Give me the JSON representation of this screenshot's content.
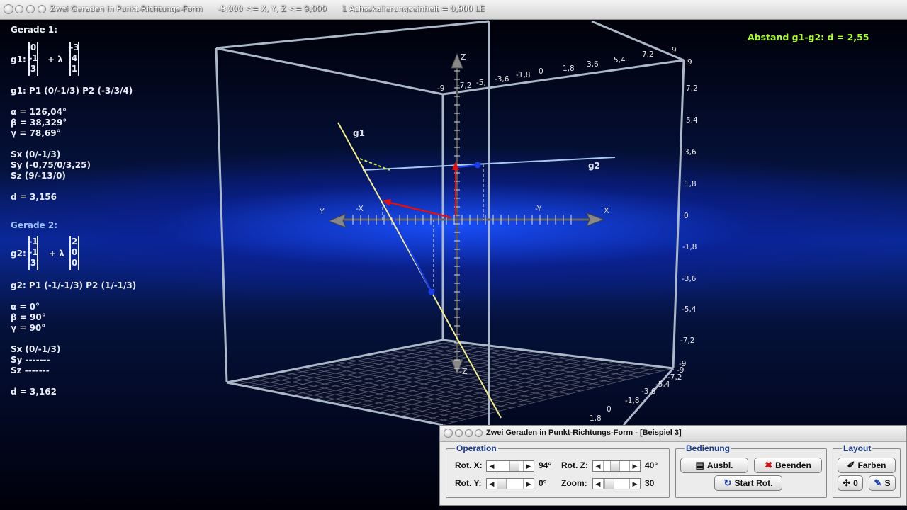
{
  "window": {
    "title": "Zwei Geraden in Punkt-Richtungs-Form",
    "range": "-9,000 <= X, Y, Z <= 9,000",
    "scale": "1 Achsskalierungseinheit = 0,900 LE"
  },
  "info": {
    "g1": {
      "header": "Gerade 1:",
      "label": "g1:",
      "point": [
        "0",
        "-1",
        "3"
      ],
      "direction": [
        "-3",
        "4",
        "1"
      ],
      "lambda": "+ λ",
      "points": "g1: P1 (0/-1/3)    P2 (-3/3/4)",
      "alpha": "α = 126,04°",
      "beta": "β = 38,329°",
      "gamma": "γ = 78,69°",
      "sx": "Sx (0/-1/3)",
      "sy": "Sy (-0,75/0/3,25)",
      "sz": "Sz (9/-13/0)",
      "d": "d = 3,156"
    },
    "g2": {
      "header": "Gerade 2:",
      "label": "g2:",
      "point": [
        "-1",
        "-1",
        "3"
      ],
      "direction": [
        "2",
        "0",
        "0"
      ],
      "lambda": "+ λ",
      "points": "g2: P1 (-1/-1/3)    P2 (1/-1/3)",
      "alpha": "α = 0°",
      "beta": "β = 90°",
      "gamma": "γ =  90°",
      "sx": "Sx (0/-1/3)",
      "sy": "Sy -------",
      "sz": "Sz -------",
      "d": "d = 3,162"
    }
  },
  "abstand": "Abstand g1-g2: d = 2,55",
  "scene": {
    "line_labels": {
      "g1": "g1",
      "g2": "g2"
    },
    "axis_labels": {
      "z_top": "Z",
      "z_bottom": "-Z",
      "x_pos": "X",
      "x_neg": "-X",
      "y_pos": "Y",
      "y_neg": "-Y"
    },
    "top_ticks": [
      "-9",
      "-7,2",
      "-5,",
      "-3,6",
      "-1,8",
      "0",
      "1,8",
      "3,6",
      "5,4",
      "7,2",
      "9"
    ],
    "right_ticks": [
      "9",
      "7,2",
      "5,4",
      "3,6",
      "1,8",
      "0",
      "-1,8",
      "-3,6",
      "-5,4",
      "-7,2",
      "-9"
    ],
    "bottom_ticks": [
      "-9",
      "-7,2",
      "-5,4",
      "-3,6",
      "-1,8",
      "0",
      "1,8"
    ],
    "colors": {
      "g1": "#f6f08a",
      "g2": "#a8c8f0",
      "red": "#e01010",
      "blue": "#1a3ce6",
      "green": "#c8f040",
      "frame": "#aab8c8"
    }
  },
  "panel": {
    "title": "Zwei Geraden in Punkt-Richtungs-Form - [Beispiel 3]",
    "operation": {
      "label": "Operation",
      "rot_x": {
        "label": "Rot. X:",
        "value": "94°"
      },
      "rot_y": {
        "label": "Rot. Y:",
        "value": "0°"
      },
      "rot_z": {
        "label": "Rot. Z:",
        "value": "40°"
      },
      "zoom": {
        "label": "Zoom:",
        "value": "30"
      }
    },
    "bedienung": {
      "label": "Bedienung",
      "ausbl": "Ausbl.",
      "beenden": "Beenden",
      "start_rot": "Start Rot."
    },
    "layout": {
      "label": "Layout",
      "farben": "Farben",
      "zero": "0",
      "s": "S"
    }
  }
}
